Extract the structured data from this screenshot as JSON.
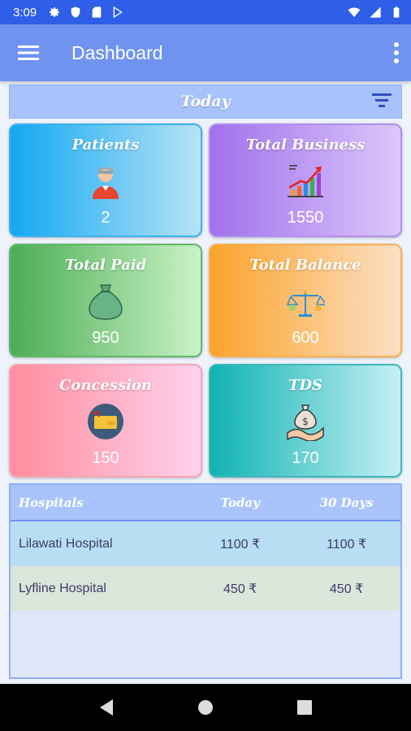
{
  "status": {
    "time": "3:09",
    "left_icons": [
      "settings-icon",
      "shield-icon",
      "sd-card-icon",
      "play-store-icon"
    ],
    "right_icons": [
      "wifi-icon",
      "signal-icon",
      "battery-icon"
    ]
  },
  "appbar": {
    "title": "Dashboard",
    "menu_icon": "hamburger-menu-icon",
    "more_icon": "more-vert-icon"
  },
  "filter": {
    "period": "Today",
    "filter_icon": "filter-icon"
  },
  "cards": [
    {
      "title": "Patients",
      "value": "2",
      "icon": "patient-icon"
    },
    {
      "title": "Total Business",
      "value": "1550",
      "icon": "growth-chart-icon"
    },
    {
      "title": "Total Paid",
      "value": "950",
      "icon": "money-bag-icon"
    },
    {
      "title": "Total Balance",
      "value": "600",
      "icon": "balance-scale-icon"
    },
    {
      "title": "Concession",
      "value": "150",
      "icon": "coupon-icon"
    },
    {
      "title": "TDS",
      "value": "170",
      "icon": "money-hand-icon"
    }
  ],
  "table": {
    "headers": [
      "Hospitals",
      "Today",
      "30 Days"
    ],
    "rows": [
      {
        "name": "Lilawati Hospital",
        "today": "1100 ₹",
        "days30": "1100 ₹"
      },
      {
        "name": "Lyfline Hospital",
        "today": "450 ₹",
        "days30": "450 ₹"
      }
    ]
  },
  "navbar": {
    "icons": [
      "back-icon",
      "home-icon",
      "recents-icon"
    ]
  },
  "colors": {
    "primary_dark": "#2f5ee8",
    "primary": "#6f93ef",
    "header_light": "#a8c3fb"
  }
}
